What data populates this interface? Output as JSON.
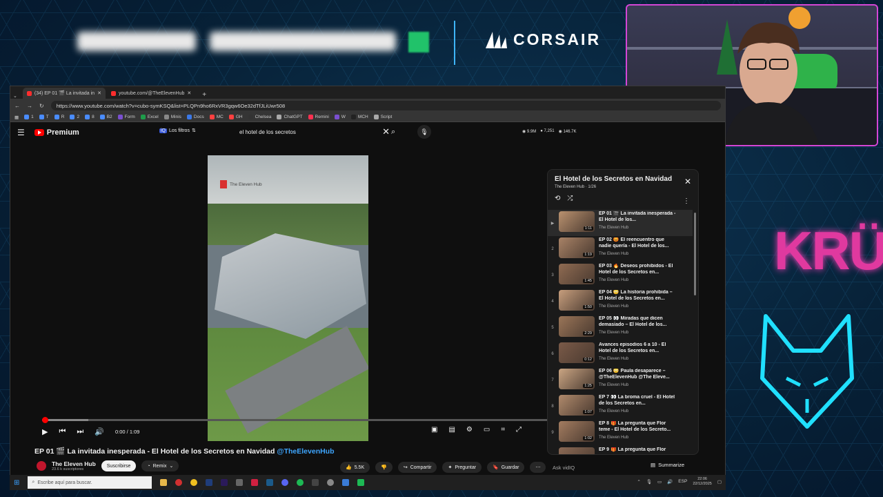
{
  "overlay": {
    "brand": "CORSAIR",
    "kru_text": "KRÜ",
    "colors": {
      "accent_blue": "#3fb6ff",
      "cam_border": "#d546d6",
      "kru_pink": "#e0399f",
      "wolf_cyan": "#20e0ff"
    }
  },
  "browser": {
    "tabs": [
      {
        "label": "(34) EP 01 🎬 La invitada in",
        "active": true
      },
      {
        "label": "youtube.com/@TheElevenHub",
        "active": false
      }
    ],
    "new_tab": "+",
    "url": "https://www.youtube.com/watch?v=cubo-symKSQ&list=PLQPn9ho6RxVR3gqw6Oe32dTfJLiUwr508",
    "bookmarks": [
      "1",
      "T",
      "R",
      "2",
      "8",
      "B2",
      "Form",
      "Excel",
      "Minis",
      "Docs",
      "MC",
      "GH",
      "Chelsea",
      "ChatGPT",
      "Remini",
      "W",
      "MCH",
      "Script"
    ]
  },
  "youtube": {
    "logo": "Premium",
    "filters": "Los filtros",
    "search_query": "el hotel de los secretos",
    "stats": [
      "9.9M",
      "7,251",
      "146.7K"
    ],
    "video": {
      "watermark": "The Eleven Hub",
      "current_time": "0:00 / 1:09",
      "progress": 0.0,
      "buffered": 0.09
    },
    "title_main": "EP 01 🎬 La invitada inesperada - El Hotel de los Secretos en Navidad",
    "title_tag": "@TheElevenHub",
    "channel": {
      "name": "The Eleven Hub",
      "subs": "23.6 k suscriptores",
      "subscribe": "Suscribirse",
      "remix": "Remix"
    },
    "actions": {
      "likes": "5.5K",
      "share": "Compartir",
      "ask": "Preguntar",
      "save": "Guardar",
      "more": "⋯"
    },
    "ask_placeholder": "Ask vidIQ",
    "summarize": "Summarize",
    "playlist": {
      "title": "El Hotel de los Secretos en Navidad",
      "subtitle": "The Eleven Hub · 1/26",
      "items": [
        {
          "idx": "▶",
          "title": "EP 01 🎬 La invitada inesperada - El Hotel de los...",
          "channel": "The Eleven Hub",
          "dur": "1:11",
          "current": true
        },
        {
          "idx": "2",
          "title": "EP 02 😡 El reencuentro que nadie quería - El Hotel de los...",
          "channel": "The Eleven Hub",
          "dur": "1:19",
          "current": false
        },
        {
          "idx": "3",
          "title": "EP 03 🔥 Deseos prohibidos - El Hotel de los Secretos en...",
          "channel": "The Eleven Hub",
          "dur": "1:45",
          "current": false
        },
        {
          "idx": "4",
          "title": "EP 04 😳 La historia prohibida – El Hotel de los Secretos en...",
          "channel": "The Eleven Hub",
          "dur": "1:50",
          "current": false
        },
        {
          "idx": "5",
          "title": "EP 05 👀 Miradas que dicen demasiado – El Hotel de los...",
          "channel": "The Eleven Hub",
          "dur": "2:29",
          "current": false
        },
        {
          "idx": "6",
          "title": "Avances episodios 6 a 10 - El Hotel de los Secretos en...",
          "channel": "The Eleven Hub",
          "dur": "0:12",
          "current": false
        },
        {
          "idx": "7",
          "title": "EP 06 😳 Paula desaparece – @TheElevenHub @The Eleve...",
          "channel": "The Eleven Hub",
          "dur": "1:25",
          "current": false
        },
        {
          "idx": "8",
          "title": "EP 7 👀 La broma cruel - El Hotel de los Secretos en...",
          "channel": "The Eleven Hub",
          "dur": "1:07",
          "current": false
        },
        {
          "idx": "9",
          "title": "EP 8 🎁 La pregunta que Flor teme - El Hotel de los Secreto...",
          "channel": "The Eleven Hub",
          "dur": "1:02",
          "current": false
        },
        {
          "idx": "10",
          "title": "EP 9 🎁 La pregunta que Flor",
          "channel": "",
          "dur": "",
          "current": false
        }
      ]
    }
  },
  "taskbar": {
    "search_placeholder": "Escribe aquí para buscar.",
    "lang": "ESP",
    "time": "22:06",
    "date": "22/12/2025"
  }
}
